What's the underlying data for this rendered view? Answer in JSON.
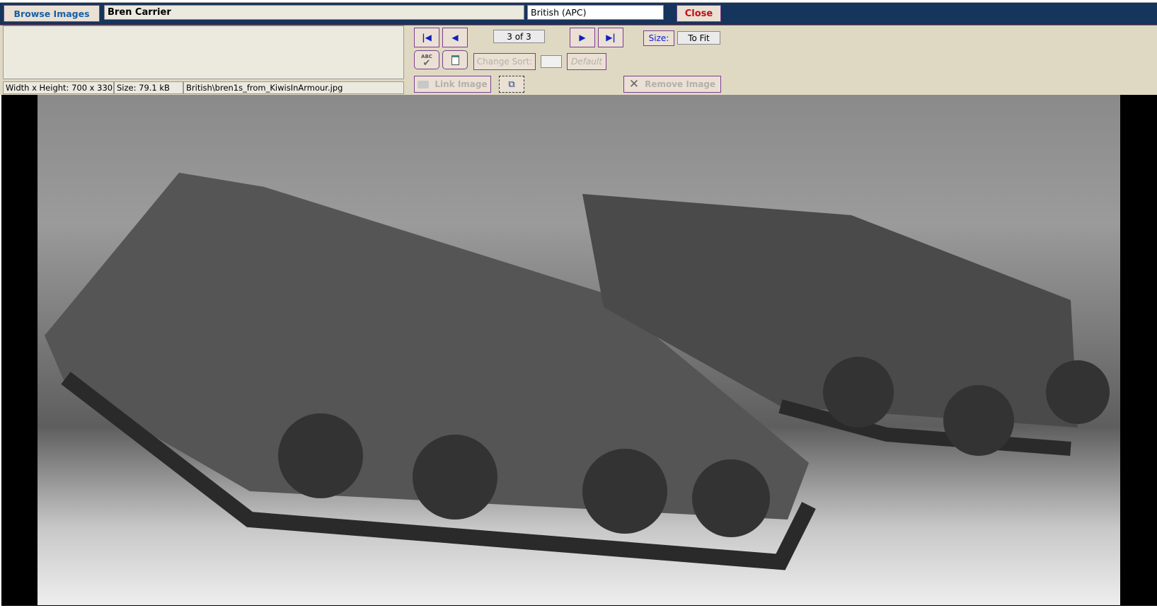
{
  "header": {
    "browse_label": "Browse Images",
    "title_value": "Bren Carrier",
    "category_value": "British (APC)",
    "close_label": "Close"
  },
  "nav": {
    "counter": "3 of 3",
    "size_label": "Size:",
    "size_value": "To Fit",
    "change_sort_label": "Change Sort:",
    "default_label": "Default",
    "link_image_label": "Link Image",
    "remove_image_label": "Remove Image",
    "spell_icon_text": "ABC"
  },
  "status": {
    "dimensions": "Width x Height: 700 x 330",
    "size": "Size: 79.1 kB",
    "path": "British\\bren1s_from_KiwisInArmour.jpg"
  },
  "colors": {
    "header_bg": "#16355c",
    "panel_bg": "#dfd9c3",
    "accent_border": "#7a3f8f",
    "close_text": "#c0101a"
  }
}
